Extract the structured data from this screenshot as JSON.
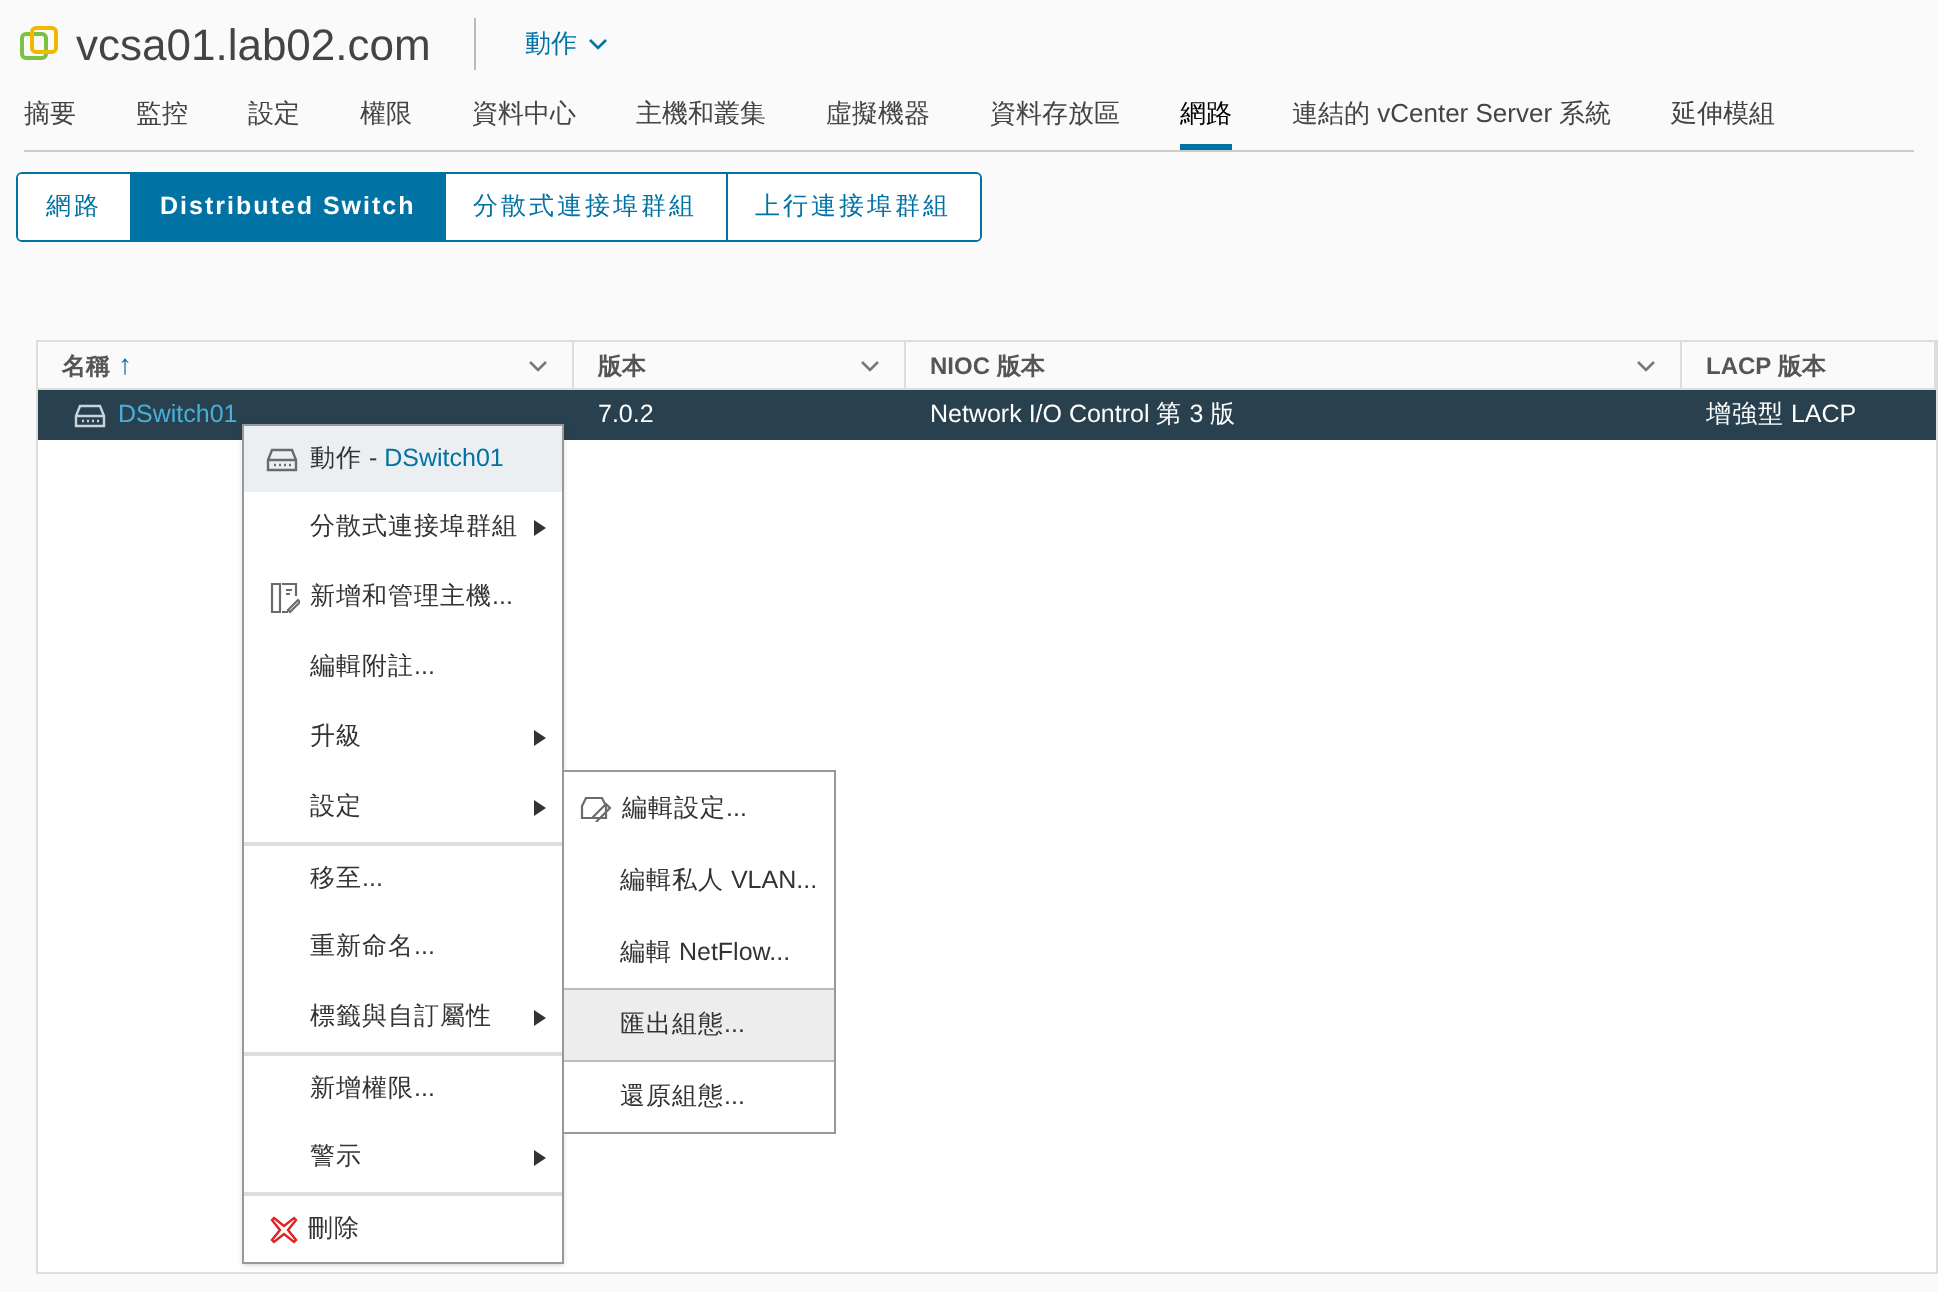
{
  "header": {
    "title": "vcsa01.lab02.com",
    "actions": "動作"
  },
  "tabs": [
    {
      "label": "摘要",
      "selected": false
    },
    {
      "label": "監控",
      "selected": false
    },
    {
      "label": "設定",
      "selected": false
    },
    {
      "label": "權限",
      "selected": false
    },
    {
      "label": "資料中心",
      "selected": false
    },
    {
      "label": "主機和叢集",
      "selected": false
    },
    {
      "label": "虛擬機器",
      "selected": false
    },
    {
      "label": "資料存放區",
      "selected": false
    },
    {
      "label": "網路",
      "selected": true
    },
    {
      "label": "連結的 vCenter Server 系統",
      "selected": false
    },
    {
      "label": "延伸模組",
      "selected": false
    }
  ],
  "subtabs": [
    {
      "label": "網路",
      "selected": false
    },
    {
      "label": "Distributed Switch",
      "selected": true
    },
    {
      "label": "分散式連接埠群組",
      "selected": false
    },
    {
      "label": "上行連接埠群組",
      "selected": false
    }
  ],
  "table": {
    "columns": [
      {
        "label": "名稱",
        "sort": "↑",
        "filter": true
      },
      {
        "label": "版本",
        "filter": true
      },
      {
        "label": "NIOC 版本",
        "filter": true
      },
      {
        "label": "LACP 版本",
        "filter": false
      }
    ],
    "rows": [
      {
        "selected": true,
        "cells": [
          "DSwitch01",
          "7.0.2",
          "Network I/O Control 第 3 版",
          "增強型 LACP"
        ]
      }
    ]
  },
  "context_menu": {
    "title": "動作 -",
    "target": "DSwitch01",
    "items": [
      {
        "kind": "plain",
        "label": "分散式連接埠群組",
        "submenu": true,
        "separator_before": false
      },
      {
        "kind": "hosts",
        "label": "新增和管理主機...",
        "submenu": false,
        "separator_before": false
      },
      {
        "kind": "plain",
        "label": "編輯附註...",
        "submenu": false,
        "separator_before": false
      },
      {
        "kind": "plain",
        "label": "升級",
        "submenu": true,
        "separator_before": false
      },
      {
        "kind": "plain",
        "label": "設定",
        "submenu": true,
        "separator_before": false
      },
      {
        "kind": "plain",
        "label": "移至...",
        "submenu": false,
        "separator_before": true
      },
      {
        "kind": "plain",
        "label": "重新命名...",
        "submenu": false,
        "separator_before": false
      },
      {
        "kind": "plain",
        "label": "標籤與自訂屬性",
        "submenu": true,
        "separator_before": false
      },
      {
        "kind": "plain",
        "label": "新增權限...",
        "submenu": false,
        "separator_before": true
      },
      {
        "kind": "plain",
        "label": "警示",
        "submenu": true,
        "separator_before": false
      },
      {
        "kind": "delete",
        "label": "刪除",
        "submenu": false,
        "separator_before": true
      }
    ]
  },
  "submenu": {
    "items": [
      {
        "kind": "settings",
        "label": "編輯設定...",
        "highlighted": false,
        "separator_before": false
      },
      {
        "kind": "plain",
        "label": "編輯私人 VLAN...",
        "highlighted": false,
        "separator_before": false
      },
      {
        "kind": "plain",
        "label": "編輯 NetFlow...",
        "highlighted": false,
        "separator_before": false
      },
      {
        "kind": "plain",
        "label": "匯出組態...",
        "highlighted": true,
        "separator_before": true
      },
      {
        "kind": "plain",
        "label": "還原組態...",
        "highlighted": false,
        "separator_before": true
      }
    ]
  }
}
